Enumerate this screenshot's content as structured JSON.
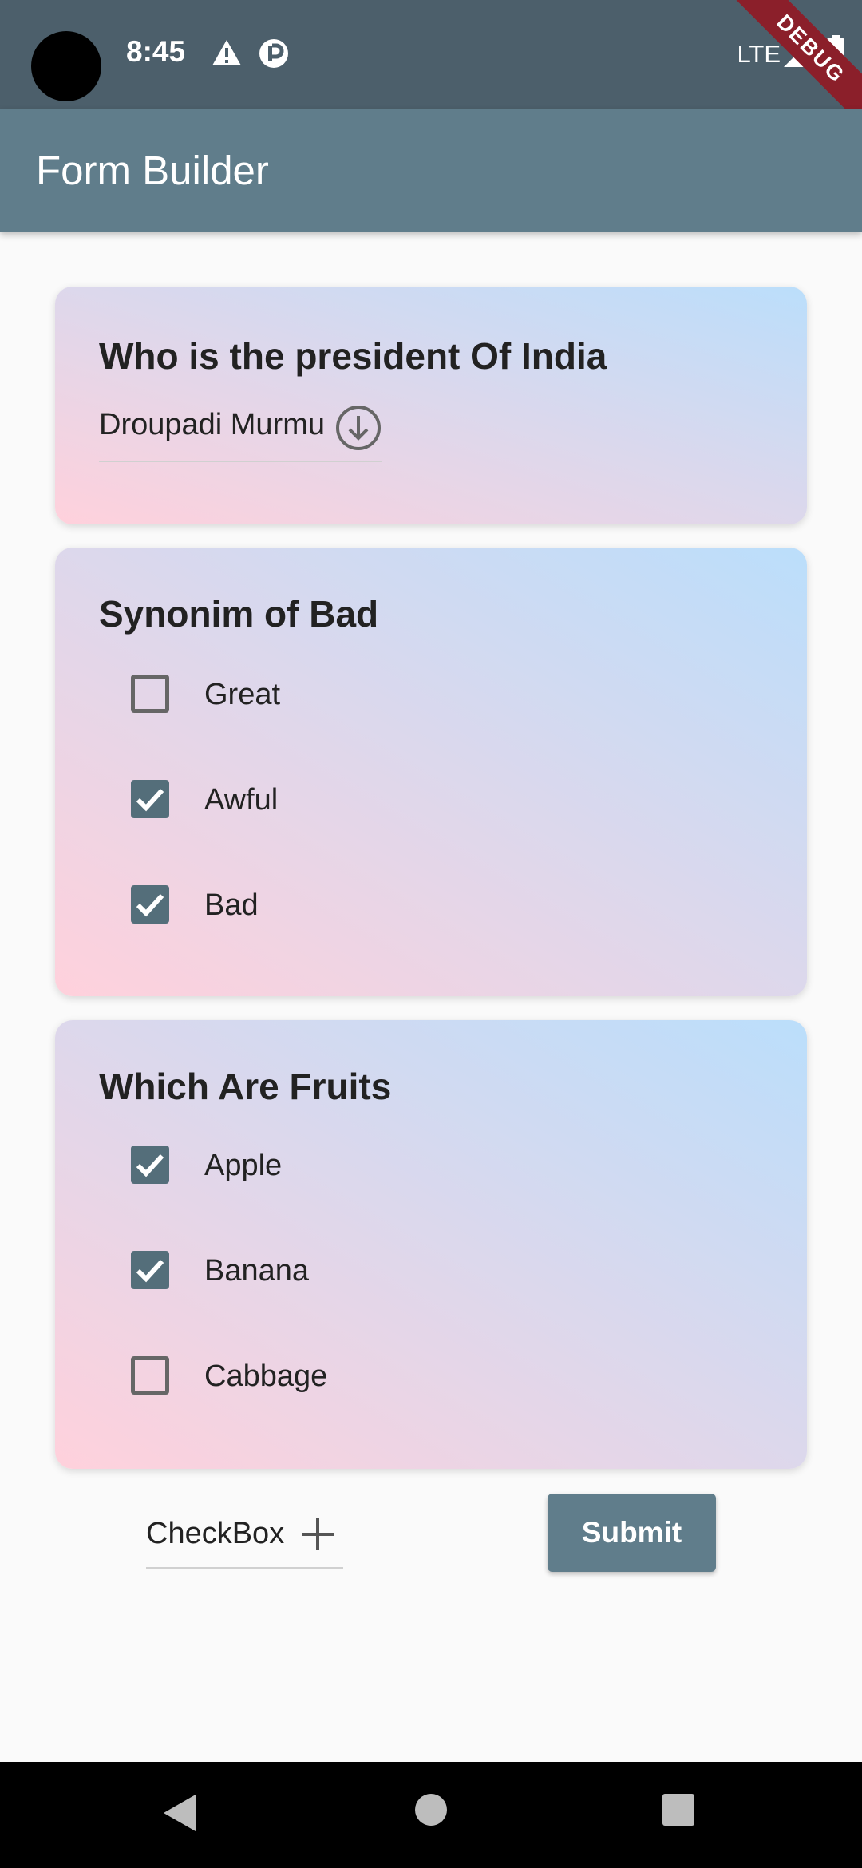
{
  "status_bar": {
    "time": "8:45",
    "network": "LTE"
  },
  "debug_banner": "DEBUG",
  "app_bar": {
    "title": "Form Builder"
  },
  "questions": [
    {
      "title": "Who is the president Of India",
      "type": "dropdown",
      "selected": "Droupadi Murmu"
    },
    {
      "title": "Synonim of Bad",
      "type": "checkbox",
      "options": [
        {
          "label": "Great",
          "checked": false
        },
        {
          "label": "Awful",
          "checked": true
        },
        {
          "label": "Bad",
          "checked": true
        }
      ]
    },
    {
      "title": "Which Are Fruits",
      "type": "checkbox",
      "options": [
        {
          "label": "Apple",
          "checked": true
        },
        {
          "label": "Banana",
          "checked": true
        },
        {
          "label": "Cabbage",
          "checked": false
        }
      ]
    }
  ],
  "footer": {
    "question_type": "CheckBox",
    "submit_label": "Submit"
  },
  "colors": {
    "app_bar": "#607d8b",
    "status_bar": "#4c5f6b",
    "checkbox_checked": "#546e7a",
    "card_gradient_start": "#ffd1dc",
    "card_gradient_end": "#bbdefb"
  },
  "icons": [
    "warning-icon",
    "app-notification-icon",
    "signal-icon",
    "battery-icon",
    "arrow-down-circle-icon",
    "check-icon",
    "plus-icon",
    "back-icon",
    "home-icon",
    "recents-icon"
  ]
}
